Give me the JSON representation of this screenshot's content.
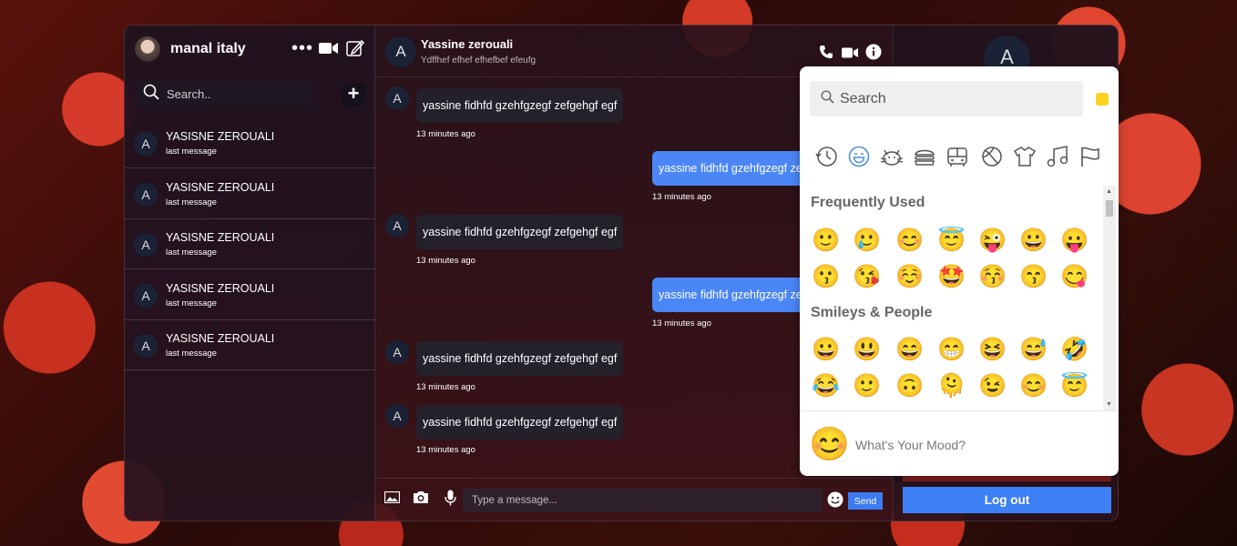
{
  "sidebar": {
    "user_name": "manal italy",
    "search_placeholder": "Search..",
    "conversations": [
      {
        "initial": "A",
        "name": "YASISNE ZEROUALI",
        "last": "last message"
      },
      {
        "initial": "A",
        "name": "YASISNE ZEROUALI",
        "last": "last message"
      },
      {
        "initial": "A",
        "name": "YASISNE ZEROUALI",
        "last": "last message"
      },
      {
        "initial": "A",
        "name": "YASISNE ZEROUALI",
        "last": "last message"
      },
      {
        "initial": "A",
        "name": "YASISNE ZEROUALI",
        "last": "last message"
      }
    ]
  },
  "chat": {
    "initial": "A",
    "name": "Yassine zerouali",
    "status": "Ydffhef efhef efhefbef efeufg",
    "messages": [
      {
        "dir": "in",
        "initial": "A",
        "text": "yassine fidhfd gzehfgzegf zefgehgf egf",
        "time": "13 minutes ago"
      },
      {
        "dir": "out",
        "text": "yassine fidhfd gzehfgzegf zefgehgf egf",
        "time": "13 minutes ago"
      },
      {
        "dir": "in",
        "initial": "A",
        "text": "yassine fidhfd gzehfgzegf zefgehgf egf",
        "time": "13 minutes ago"
      },
      {
        "dir": "out",
        "text": "yassine fidhfd gzehfgzegf zefgehgf egf",
        "time": "13 minutes ago"
      },
      {
        "dir": "in",
        "initial": "A",
        "text": "yassine fidhfd gzehfgzegf zefgehgf egf",
        "time": "13 minutes ago"
      },
      {
        "dir": "in",
        "initial": "A",
        "text": "yassine fidhfd gzehfgzegf zefgehgf egf",
        "time": "13 minutes ago"
      }
    ],
    "input_placeholder": "Type a message...",
    "send_label": "Send"
  },
  "profile": {
    "initial": "A",
    "logout_label": "Log out"
  },
  "emoji_picker": {
    "search_placeholder": "Search",
    "skin_tone_color": "#ffd21f",
    "categories": [
      "recent-icon",
      "smileys-icon",
      "animals-icon",
      "food-icon",
      "travel-icon",
      "activity-icon",
      "objects-icon",
      "symbols-icon",
      "flags-icon"
    ],
    "sections": [
      {
        "title": "Frequently Used",
        "emojis": [
          "🙂",
          "🥲",
          "😊",
          "😇",
          "😜",
          "😀",
          "😛",
          "😗",
          "😘",
          "☺️",
          "🤩",
          "😚",
          "😙",
          "😋"
        ]
      },
      {
        "title": "Smileys & People",
        "emojis": [
          "😀",
          "😃",
          "😄",
          "😁",
          "😆",
          "😅",
          "🤣",
          "😂",
          "🙂",
          "🙃",
          "🫠",
          "😉",
          "😊",
          "😇"
        ]
      }
    ],
    "preview_emoji": "😊",
    "preview_text": "What's Your Mood?"
  },
  "colors": {
    "accent": "#3d7ff4",
    "outgoing_bubble": "#4a86f6",
    "incoming_bubble": "#24212b"
  }
}
